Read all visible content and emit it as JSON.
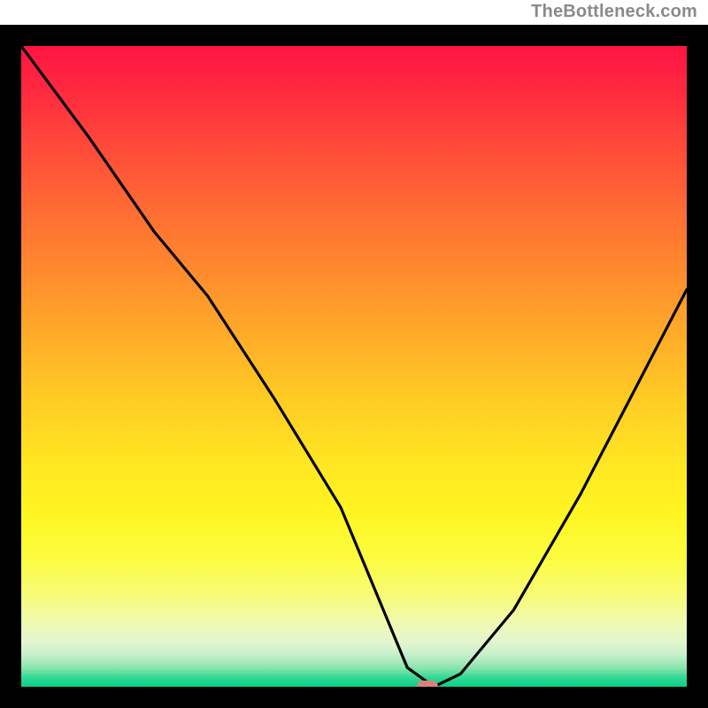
{
  "attribution": "TheBottleneck.com",
  "chart_data": {
    "type": "line",
    "title": "",
    "xlabel": "",
    "ylabel": "",
    "xlim": [
      0,
      100
    ],
    "ylim": [
      0,
      100
    ],
    "x": [
      0,
      10,
      20,
      28,
      38,
      48,
      54,
      58,
      62,
      66,
      74,
      84,
      94,
      100
    ],
    "values": [
      100,
      86,
      71,
      61,
      45,
      28,
      13,
      3,
      0,
      2,
      12,
      30,
      50,
      62
    ],
    "marker": {
      "x": 61,
      "y": 0
    },
    "gradient_stops": [
      {
        "pos": 0,
        "color": "#ff1443"
      },
      {
        "pos": 0.5,
        "color": "#ffcb24"
      },
      {
        "pos": 0.8,
        "color": "#fcfd3f"
      },
      {
        "pos": 1.0,
        "color": "#07d189"
      }
    ]
  },
  "colors": {
    "frame": "#000000",
    "curve": "#000000",
    "marker": "#d9827b",
    "attribution_text": "#8a8a8a"
  }
}
